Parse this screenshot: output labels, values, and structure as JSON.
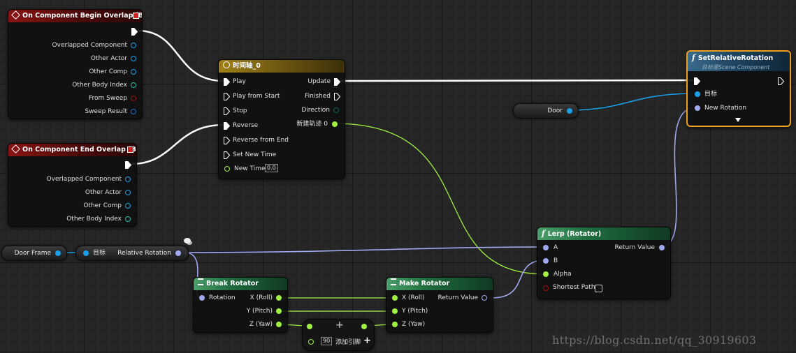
{
  "colors": {
    "exec": "#ffffff",
    "object_pin": "#1aa0e8",
    "rotator_pin": "#a0a8f0",
    "float_pin": "#a0f040",
    "struct_pin": "#20c0a0",
    "bool_pin": "#a01010",
    "event_header": "#8a1414",
    "timeline_header": "#a08018",
    "function_header": "#1e6a3e",
    "target_header": "#1e4562",
    "selection": "#f0a020"
  },
  "nodes": {
    "begin_overlap": {
      "title": "On Component Begin Overlap (Box)",
      "pins": [
        "Overlapped Component",
        "Other Actor",
        "Other Comp",
        "Other Body Index",
        "From Sweep",
        "Sweep Result"
      ]
    },
    "end_overlap": {
      "title": "On Component End Overlap (Box)",
      "pins": [
        "Overlapped Component",
        "Other Actor",
        "Other Comp",
        "Other Body Index"
      ]
    },
    "timeline": {
      "title": "时间轴_0",
      "inputs": [
        "Play",
        "Play from Start",
        "Stop",
        "Reverse",
        "Reverse from End",
        "Set New Time",
        "New Time"
      ],
      "outputs": [
        "Update",
        "Finished",
        "Direction",
        "新建轨迹 0"
      ],
      "new_time_value": "0.0"
    },
    "set_relative_rotation": {
      "title": "SetRelativeRotation",
      "subtitle": "目标是Scene Component",
      "pins": [
        "目标",
        "New Rotation"
      ],
      "expand_icon": "triangle-down-icon"
    },
    "door_var": {
      "label": "Door"
    },
    "door_frame_var": {
      "label": "Door Frame"
    },
    "get_relative_rotation": {
      "target": "目标",
      "output": "Relative Rotation"
    },
    "lerp": {
      "title": "Lerp (Rotator)",
      "inputs": [
        "A",
        "B",
        "Alpha",
        "Shortest Path"
      ],
      "output": "Return Value"
    },
    "break_rotator": {
      "title": "Break Rotator",
      "input": "Rotation",
      "outputs": [
        "X (Roll)",
        "Y (Pitch)",
        "Z (Yaw)"
      ]
    },
    "make_rotator": {
      "title": "Make Rotator",
      "inputs": [
        "X (Roll)",
        "Y (Pitch)",
        "Z (Yaw)"
      ],
      "output": "Return Value"
    },
    "add_node": {
      "value": "90",
      "add_pin_label": "添加引脚"
    }
  },
  "watermark": "https://blog.csdn.net/qq_30919603"
}
